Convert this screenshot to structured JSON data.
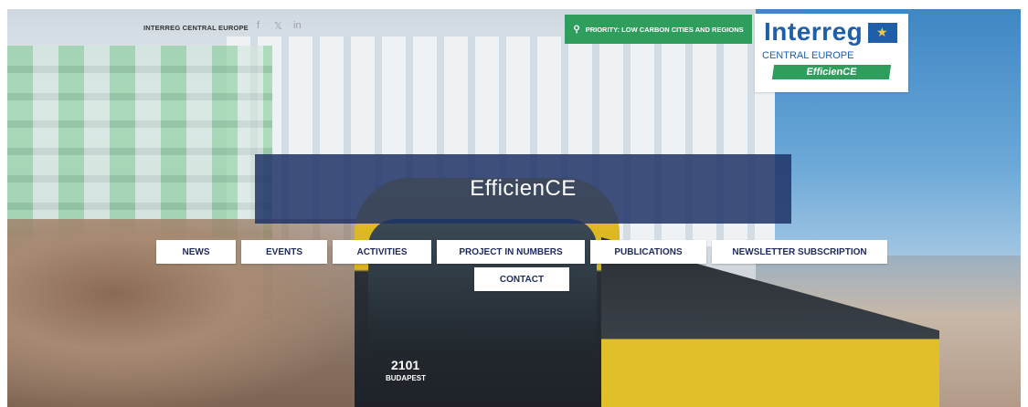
{
  "header": {
    "brand": "INTERREG CENTRAL EUROPE",
    "social": [
      {
        "icon": "facebook-icon",
        "glyph": "f"
      },
      {
        "icon": "twitter-icon",
        "glyph": "𝕏"
      },
      {
        "icon": "linkedin-icon",
        "glyph": "in"
      }
    ],
    "priority_label": "PRIORITY: LOW CARBON CITIES AND REGIONS",
    "priority_icon": "lightbulb-icon",
    "logo": {
      "title": "Interreg",
      "region": "CENTRAL EUROPE",
      "project": "EfficienCE"
    }
  },
  "hero": {
    "title": "EfficienCE",
    "tram_number": "2101",
    "tram_brand": "BUDAPEST"
  },
  "nav": {
    "items": [
      {
        "id": "news",
        "label": "NEWS"
      },
      {
        "id": "events",
        "label": "EVENTS"
      },
      {
        "id": "activities",
        "label": "ACTIVITIES"
      },
      {
        "id": "project-in-numbers",
        "label": "PROJECT IN NUMBERS"
      },
      {
        "id": "publications",
        "label": "PUBLICATIONS"
      },
      {
        "id": "newsletter-subscription",
        "label": "NEWSLETTER SUBSCRIPTION"
      },
      {
        "id": "contact",
        "label": "CONTACT"
      }
    ]
  },
  "colors": {
    "accent_green": "#2f9e5d",
    "brand_blue": "#1f5ea8",
    "title_overlay": "#1f3266"
  }
}
